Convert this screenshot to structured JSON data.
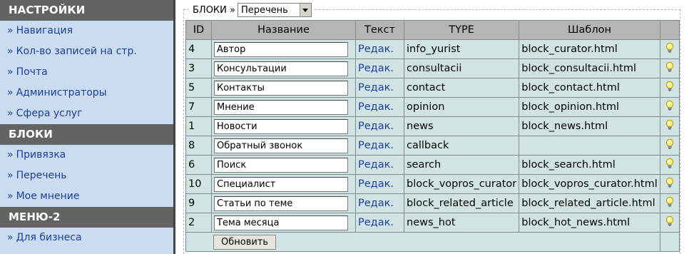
{
  "sidebar": {
    "sections": [
      {
        "title": "НАСТРОЙКИ",
        "items": [
          "Навигация",
          "Кол-во записей на стр.",
          "Почта",
          "Администраторы",
          "Сфера услуг"
        ]
      },
      {
        "title": "БЛОКИ",
        "items": [
          "Привязка",
          "Перечень",
          "Мое мнение"
        ]
      },
      {
        "title": "МЕНЮ-2",
        "items": [
          "Для бизнеса"
        ]
      }
    ],
    "item_prefix": "»"
  },
  "filter": {
    "label": "БЛОКИ »",
    "selected": "Перечень"
  },
  "table": {
    "headers": {
      "id": "ID",
      "name": "Название",
      "text": "Текст",
      "type": "TYPE",
      "template": "Шаблон"
    },
    "edit_label": "Редак.",
    "rows": [
      {
        "id": "4",
        "name": "Автор",
        "type": "info_yurist",
        "template": "block_curator.html"
      },
      {
        "id": "3",
        "name": "Консультации",
        "type": "consultacii",
        "template": "block_consultacii.html"
      },
      {
        "id": "5",
        "name": "Контакты",
        "type": "contact",
        "template": "block_contact.html"
      },
      {
        "id": "7",
        "name": "Мнение",
        "type": "opinion",
        "template": "block_opinion.html"
      },
      {
        "id": "1",
        "name": "Новости",
        "type": "news",
        "template": "block_news.html"
      },
      {
        "id": "8",
        "name": "Обратный звонок",
        "type": "callback",
        "template": ""
      },
      {
        "id": "6",
        "name": "Поиск",
        "type": "search",
        "template": "block_search.html"
      },
      {
        "id": "10",
        "name": "Специалист",
        "type": "block_vopros_curator",
        "template": "block_vopros_curator.html"
      },
      {
        "id": "9",
        "name": "Статьи по теме",
        "type": "block_related_article",
        "template": "block_related_article.html"
      },
      {
        "id": "2",
        "name": "Тема месяца",
        "type": "news_hot",
        "template": "block_hot_news.html"
      }
    ],
    "row_icon": "lightbulb-icon",
    "save_label": "Обновить"
  },
  "colors": {
    "sidebar_bg": "#ccdcf0",
    "section_header_bg": "#636363",
    "link": "#1a3fa2",
    "table_header_bg": "#b5b5b5",
    "table_cell_bg": "#d2e3e3"
  }
}
